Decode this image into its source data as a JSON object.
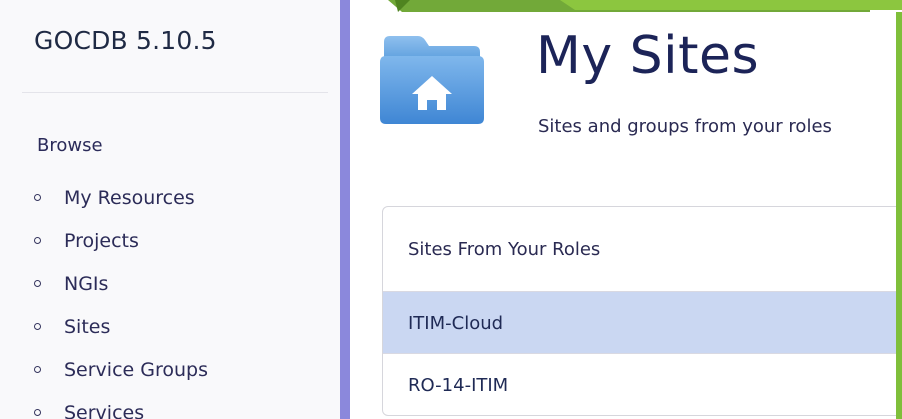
{
  "app": {
    "title": "GOCDB 5.10.5"
  },
  "sidebar": {
    "section_heading": "Browse",
    "items": [
      {
        "label": "My Resources"
      },
      {
        "label": "Projects"
      },
      {
        "label": "NGIs"
      },
      {
        "label": "Sites"
      },
      {
        "label": "Service Groups"
      },
      {
        "label": "Services"
      }
    ]
  },
  "header": {
    "title": "My Sites",
    "subtitle": "Sites and groups from your roles",
    "icon": "home-folder-icon"
  },
  "panel": {
    "heading": "Sites From Your Roles",
    "rows": [
      {
        "label": "ITIM-Cloud",
        "selected": true
      },
      {
        "label": "RO-14-ITIM",
        "selected": false
      }
    ]
  },
  "colors": {
    "sidebar_accent": "#8b88dc",
    "selected_row": "#cad7f2",
    "decor_green": "#74b032"
  }
}
